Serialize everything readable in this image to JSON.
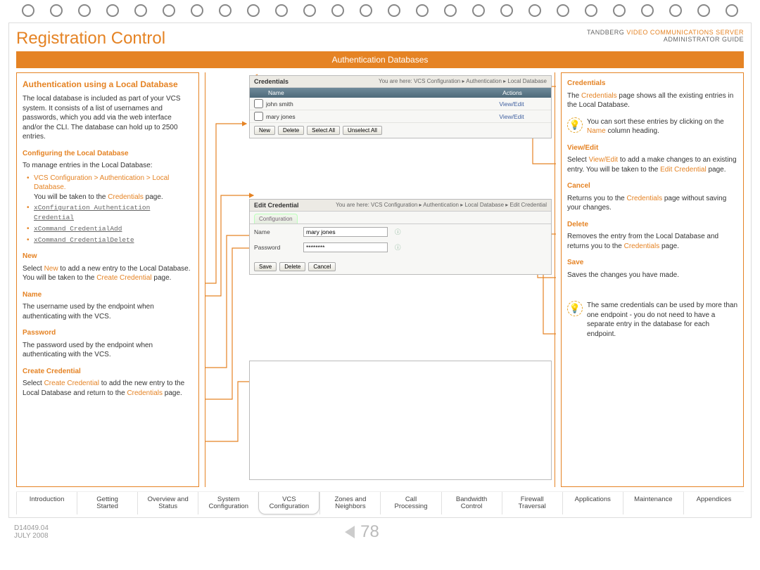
{
  "header": {
    "title": "Registration Control",
    "brand_prefix": "TANDBERG ",
    "brand_product": "VIDEO COMMUNICATIONS SERVER",
    "subtitle": "ADMINISTRATOR GUIDE"
  },
  "banner": "Authentication Databases",
  "left": {
    "h_auth": "Authentication using a Local Database",
    "p_auth": "The local database is included as part of your VCS system.  It consists of a list of usernames and passwords, which you add via the web interface and/or the CLI.  The database can hold up to 2500 entries.",
    "h_conf": "Configuring the Local Database",
    "p_manage": "To manage entries in the Local Database:",
    "li1a": "VCS Configuration > Authentication > Local Database.",
    "li1b_pre": "You will be taken to the ",
    "li1b_link": "Credentials",
    "li1b_post": " page.",
    "li2": "xConfiguration Authentication Credential",
    "li3": "xCommand CredentialAdd",
    "li4": "xCommand CredentialDelete",
    "h_new": "New",
    "p_new_pre": "Select ",
    "p_new_link": "New",
    "p_new_mid": " to add a new entry to the Local Database.  You will be taken to the ",
    "p_new_link2": "Create Credential",
    "p_new_post": " page.",
    "h_name": "Name",
    "p_name": "The username used by the endpoint when authenticating with the VCS.",
    "h_pw": "Password",
    "p_pw": "The password used by the endpoint when authenticating with the VCS.",
    "h_create": "Create Credential",
    "p_create_pre": "Select ",
    "p_create_link": "Create Credential",
    "p_create_mid": " to add the new entry to the Local Database and return to the ",
    "p_create_link2": "Credentials",
    "p_create_post": " page."
  },
  "right": {
    "h_cred": "Credentials",
    "p_cred_pre": "The ",
    "p_cred_link": "Credentials",
    "p_cred_post": " page shows all the existing entries in the Local Database.",
    "tip1_pre": "You can sort these entries by clicking on the ",
    "tip1_link": "Name",
    "tip1_post": " column heading.",
    "h_view": "View/Edit",
    "p_view_pre": "Select ",
    "p_view_link": "View/Edit",
    "p_view_mid": " to add a make changes to an existing entry. You will be taken to the ",
    "p_view_link2": "Edit Credential",
    "p_view_post": " page.",
    "h_cancel": "Cancel",
    "p_cancel_pre": "Returns you to the ",
    "p_cancel_link": "Credentials",
    "p_cancel_post": " page without saving your changes.",
    "h_delete": "Delete",
    "p_delete_pre": "Removes the entry from the Local Database and returns you to the ",
    "p_delete_link": "Credentials",
    "p_delete_post": " page.",
    "h_save": "Save",
    "p_save": "Saves the changes you have made.",
    "tip2": "The same credentials can be used by more than one endpoint - you do not need to have a separate entry in the database for each endpoint."
  },
  "mid": {
    "panel1": {
      "title": "Credentials",
      "crumbs": "You are here: VCS Configuration ▸ Authentication ▸ Local Database",
      "th_name": "Name",
      "th_actions": "Actions",
      "row1_name": "john smith",
      "row1_action": "View/Edit",
      "row2_name": "mary jones",
      "row2_action": "View/Edit",
      "btn_new": "New",
      "btn_delete": "Delete",
      "btn_selectall": "Select All",
      "btn_unselectall": "Unselect All"
    },
    "panel2": {
      "title": "Edit Credential",
      "crumbs": "You are here: VCS Configuration ▸ Authentication ▸ Local Database ▸ Edit Credential",
      "tab": "Configuration",
      "lbl_name": "Name",
      "val_name": "mary jones",
      "lbl_pw": "Password",
      "val_pw": "********",
      "btn_save": "Save",
      "btn_delete": "Delete",
      "btn_cancel": "Cancel"
    }
  },
  "tabs": [
    "Introduction",
    "Getting Started",
    "Overview and Status",
    "System Configuration",
    "VCS Configuration",
    "Zones and Neighbors",
    "Call Processing",
    "Bandwidth Control",
    "Firewall Traversal",
    "Applications",
    "Maintenance",
    "Appendices"
  ],
  "active_tab_index": 4,
  "footer": {
    "docid": "D14049.04",
    "date": "JULY 2008",
    "page": "78"
  }
}
